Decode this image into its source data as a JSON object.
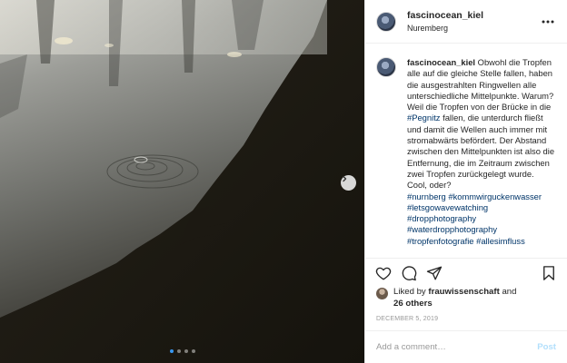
{
  "post": {
    "username": "fascinocean_kiel",
    "location": "Nuremberg",
    "caption": {
      "author": "fascinocean_kiel",
      "text_before_tag": "Obwohl die Tropfen alle auf die gleiche Stelle fallen, haben die ausgestrahlten Ringwellen alle unterschiedliche Mittelpunkte. Warum? Weil die Tropfen von der Brücke in die ",
      "inline_tag": "#Pegnitz",
      "text_after_tag": " fallen, die unterdurch fließt und damit die Wellen auch immer mit stromabwärts befördert. Der Abstand zwischen den Mittelpunkten ist also die Entfernung, die im Zeitraum zwischen zwei Tropfen zurückgelegt wurde. Cool, oder?",
      "hashtag_lines": [
        [
          "#nurnberg",
          "#kommwirguckenwasser"
        ],
        [
          "#letsgowavewatching"
        ],
        [
          "#dropphotography"
        ],
        [
          "#waterdropphotography"
        ],
        [
          "#tropfenfotografie",
          "#allesimfluss"
        ]
      ]
    },
    "likes": {
      "prefix": "Liked by",
      "liker": "frauwissenschaft",
      "conjunction": "and",
      "others": "26 others"
    },
    "date": "DECEMBER 5, 2019",
    "comment_input": {
      "placeholder": "Add a comment…",
      "value": ""
    },
    "post_button": "Post",
    "carousel": {
      "total": 4,
      "active_index": 0
    }
  },
  "icons": {
    "more": "more-horizontal-icon",
    "like": "heart-icon",
    "comment": "comment-bubble-icon",
    "share": "paper-plane-icon",
    "save": "bookmark-icon",
    "next": "chevron-right-icon"
  },
  "colors": {
    "link": "#003569",
    "post_disabled": "#b2dffc",
    "active_dot": "#3897f0",
    "muted": "#999999"
  }
}
